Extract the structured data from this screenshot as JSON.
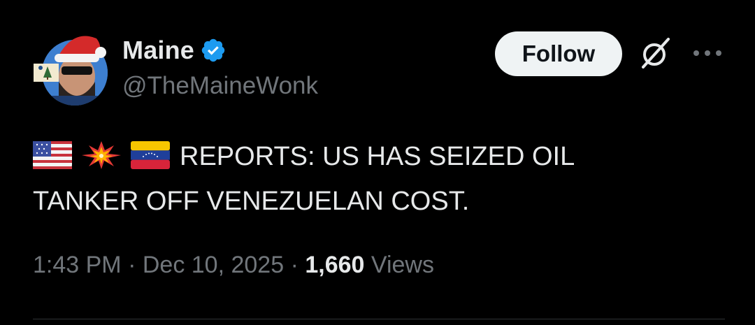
{
  "author": {
    "display_name": "Maine",
    "handle": "@TheMaineWonk",
    "verified": true
  },
  "actions": {
    "follow_label": "Follow",
    "grok_icon": "grok-icon",
    "more_icon": "more-icon"
  },
  "tweet": {
    "emojis": [
      "us-flag",
      "collision",
      "venezuela-flag"
    ],
    "line1": "REPORTS: US HAS SEIZED OIL",
    "line2": "TANKER OFF VENEZUELAN COST."
  },
  "meta": {
    "time": "1:43 PM",
    "separator": "·",
    "date": "Dec 10, 2025",
    "views_count": "1,660",
    "views_label": "Views"
  },
  "colors": {
    "background": "#000000",
    "primary_text": "#e7e9ea",
    "secondary_text": "#71767b",
    "verified_blue": "#1d9bf0",
    "follow_bg": "#eff3f4"
  }
}
